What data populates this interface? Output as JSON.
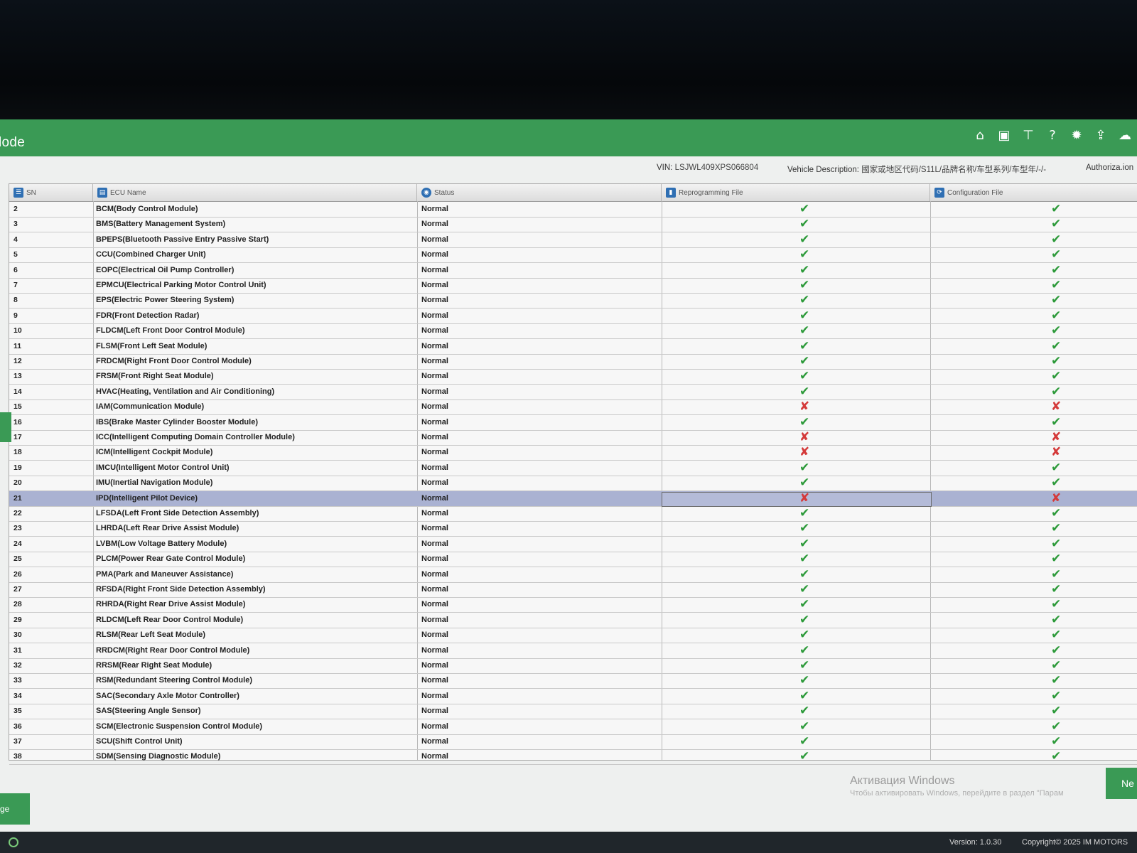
{
  "window": {
    "title": "lode"
  },
  "toolbar": {
    "icons": [
      "home-icon",
      "save-icon",
      "network-icon",
      "help-icon",
      "settings-icon",
      "upload-icon",
      "cloud-icon"
    ]
  },
  "info": {
    "vin_label": "VIN:",
    "vin_value": "LSJWL409XPS066804",
    "desc_label": "Vehicle Description:",
    "desc_value": "國家或地区代码/S11L/品牌名称/车型系列/车型年/-/-",
    "auth_label": "Authoriza.ion"
  },
  "table": {
    "headers": {
      "sn": "SN",
      "ecu": "ECU Name",
      "status": "Status",
      "repro": "Reprogramming File",
      "config": "Configuration File"
    },
    "rows": [
      {
        "sn": "2",
        "ecu": "BCM(Body Control Module)",
        "status": "Normal",
        "repro": "✔",
        "config": "✔"
      },
      {
        "sn": "3",
        "ecu": "BMS(Battery Management System)",
        "status": "Normal",
        "repro": "✔",
        "config": "✔"
      },
      {
        "sn": "4",
        "ecu": "BPEPS(Bluetooth Passive Entry Passive Start)",
        "status": "Normal",
        "repro": "✔",
        "config": "✔"
      },
      {
        "sn": "5",
        "ecu": "CCU(Combined Charger Unit)",
        "status": "Normal",
        "repro": "✔",
        "config": "✔"
      },
      {
        "sn": "6",
        "ecu": "EOPC(Electrical Oil Pump Controller)",
        "status": "Normal",
        "repro": "✔",
        "config": "✔"
      },
      {
        "sn": "7",
        "ecu": "EPMCU(Electrical Parking Motor Control Unit)",
        "status": "Normal",
        "repro": "✔",
        "config": "✔"
      },
      {
        "sn": "8",
        "ecu": "EPS(Electric Power Steering System)",
        "status": "Normal",
        "repro": "✔",
        "config": "✔"
      },
      {
        "sn": "9",
        "ecu": "FDR(Front Detection Radar)",
        "status": "Normal",
        "repro": "✔",
        "config": "✔"
      },
      {
        "sn": "10",
        "ecu": "FLDCM(Left Front Door Control Module)",
        "status": "Normal",
        "repro": "✔",
        "config": "✔"
      },
      {
        "sn": "11",
        "ecu": "FLSM(Front Left Seat Module)",
        "status": "Normal",
        "repro": "✔",
        "config": "✔"
      },
      {
        "sn": "12",
        "ecu": "FRDCM(Right Front Door Control Module)",
        "status": "Normal",
        "repro": "✔",
        "config": "✔"
      },
      {
        "sn": "13",
        "ecu": "FRSM(Front Right Seat Module)",
        "status": "Normal",
        "repro": "✔",
        "config": "✔"
      },
      {
        "sn": "14",
        "ecu": "HVAC(Heating, Ventilation and Air Conditioning)",
        "status": "Normal",
        "repro": "✔",
        "config": "✔"
      },
      {
        "sn": "15",
        "ecu": "IAM(Communication Module)",
        "status": "Normal",
        "repro": "✘",
        "config": "✘"
      },
      {
        "sn": "16",
        "ecu": "IBS(Brake Master Cylinder Booster Module)",
        "status": "Normal",
        "repro": "✔",
        "config": "✔"
      },
      {
        "sn": "17",
        "ecu": "ICC(Intelligent Computing Domain Controller Module)",
        "status": "Normal",
        "repro": "✘",
        "config": "✘"
      },
      {
        "sn": "18",
        "ecu": "ICM(Intelligent Cockpit Module)",
        "status": "Normal",
        "repro": "✘",
        "config": "✘"
      },
      {
        "sn": "19",
        "ecu": "IMCU(Intelligent Motor Control Unit)",
        "status": "Normal",
        "repro": "✔",
        "config": "✔"
      },
      {
        "sn": "20",
        "ecu": "IMU(Inertial Navigation Module)",
        "status": "Normal",
        "repro": "✔",
        "config": "✔"
      },
      {
        "sn": "21",
        "ecu": "IPD(Intelligent Pilot Device)",
        "status": "Normal",
        "repro": "✘",
        "config": "✘",
        "selected": true
      },
      {
        "sn": "22",
        "ecu": "LFSDA(Left Front Side Detection Assembly)",
        "status": "Normal",
        "repro": "✔",
        "config": "✔"
      },
      {
        "sn": "23",
        "ecu": "LHRDA(Left Rear Drive Assist Module)",
        "status": "Normal",
        "repro": "✔",
        "config": "✔"
      },
      {
        "sn": "24",
        "ecu": "LVBM(Low Voltage Battery Module)",
        "status": "Normal",
        "repro": "✔",
        "config": "✔"
      },
      {
        "sn": "25",
        "ecu": "PLCM(Power Rear Gate Control Module)",
        "status": "Normal",
        "repro": "✔",
        "config": "✔"
      },
      {
        "sn": "26",
        "ecu": "PMA(Park and Maneuver Assistance)",
        "status": "Normal",
        "repro": "✔",
        "config": "✔"
      },
      {
        "sn": "27",
        "ecu": "RFSDA(Right Front Side Detection Assembly)",
        "status": "Normal",
        "repro": "✔",
        "config": "✔"
      },
      {
        "sn": "28",
        "ecu": "RHRDA(Right Rear Drive Assist Module)",
        "status": "Normal",
        "repro": "✔",
        "config": "✔"
      },
      {
        "sn": "29",
        "ecu": "RLDCM(Left Rear Door Control Module)",
        "status": "Normal",
        "repro": "✔",
        "config": "✔"
      },
      {
        "sn": "30",
        "ecu": "RLSM(Rear Left Seat Module)",
        "status": "Normal",
        "repro": "✔",
        "config": "✔"
      },
      {
        "sn": "31",
        "ecu": "RRDCM(Right Rear Door Control Module)",
        "status": "Normal",
        "repro": "✔",
        "config": "✔"
      },
      {
        "sn": "32",
        "ecu": "RRSM(Rear Right Seat Module)",
        "status": "Normal",
        "repro": "✔",
        "config": "✔"
      },
      {
        "sn": "33",
        "ecu": "RSM(Redundant Steering Control Module)",
        "status": "Normal",
        "repro": "✔",
        "config": "✔"
      },
      {
        "sn": "34",
        "ecu": "SAC(Secondary Axle Motor Controller)",
        "status": "Normal",
        "repro": "✔",
        "config": "✔"
      },
      {
        "sn": "35",
        "ecu": "SAS(Steering Angle Sensor)",
        "status": "Normal",
        "repro": "✔",
        "config": "✔"
      },
      {
        "sn": "36",
        "ecu": "SCM(Electronic Suspension Control Module)",
        "status": "Normal",
        "repro": "✔",
        "config": "✔"
      },
      {
        "sn": "37",
        "ecu": "SCU(Shift Control Unit)",
        "status": "Normal",
        "repro": "✔",
        "config": "✔"
      },
      {
        "sn": "38",
        "ecu": "SDM(Sensing Diagnostic Module)",
        "status": "Normal",
        "repro": "✔",
        "config": "✔"
      }
    ]
  },
  "buttons": {
    "back_label": "ge",
    "next_label": "Ne"
  },
  "watermark": {
    "title": "Активация Windows",
    "subtitle": "Чтобы активировать Windows, перейдите в раздел \"Парам"
  },
  "footer": {
    "version": "Version:   1.0.30",
    "copyright": "Copyright© 2025 IM MOTORS"
  },
  "colors": {
    "brand_green": "#3a9a55",
    "ok_green": "#2d9a3a",
    "error_red": "#d43a3a",
    "selection": "#aab2d2"
  }
}
